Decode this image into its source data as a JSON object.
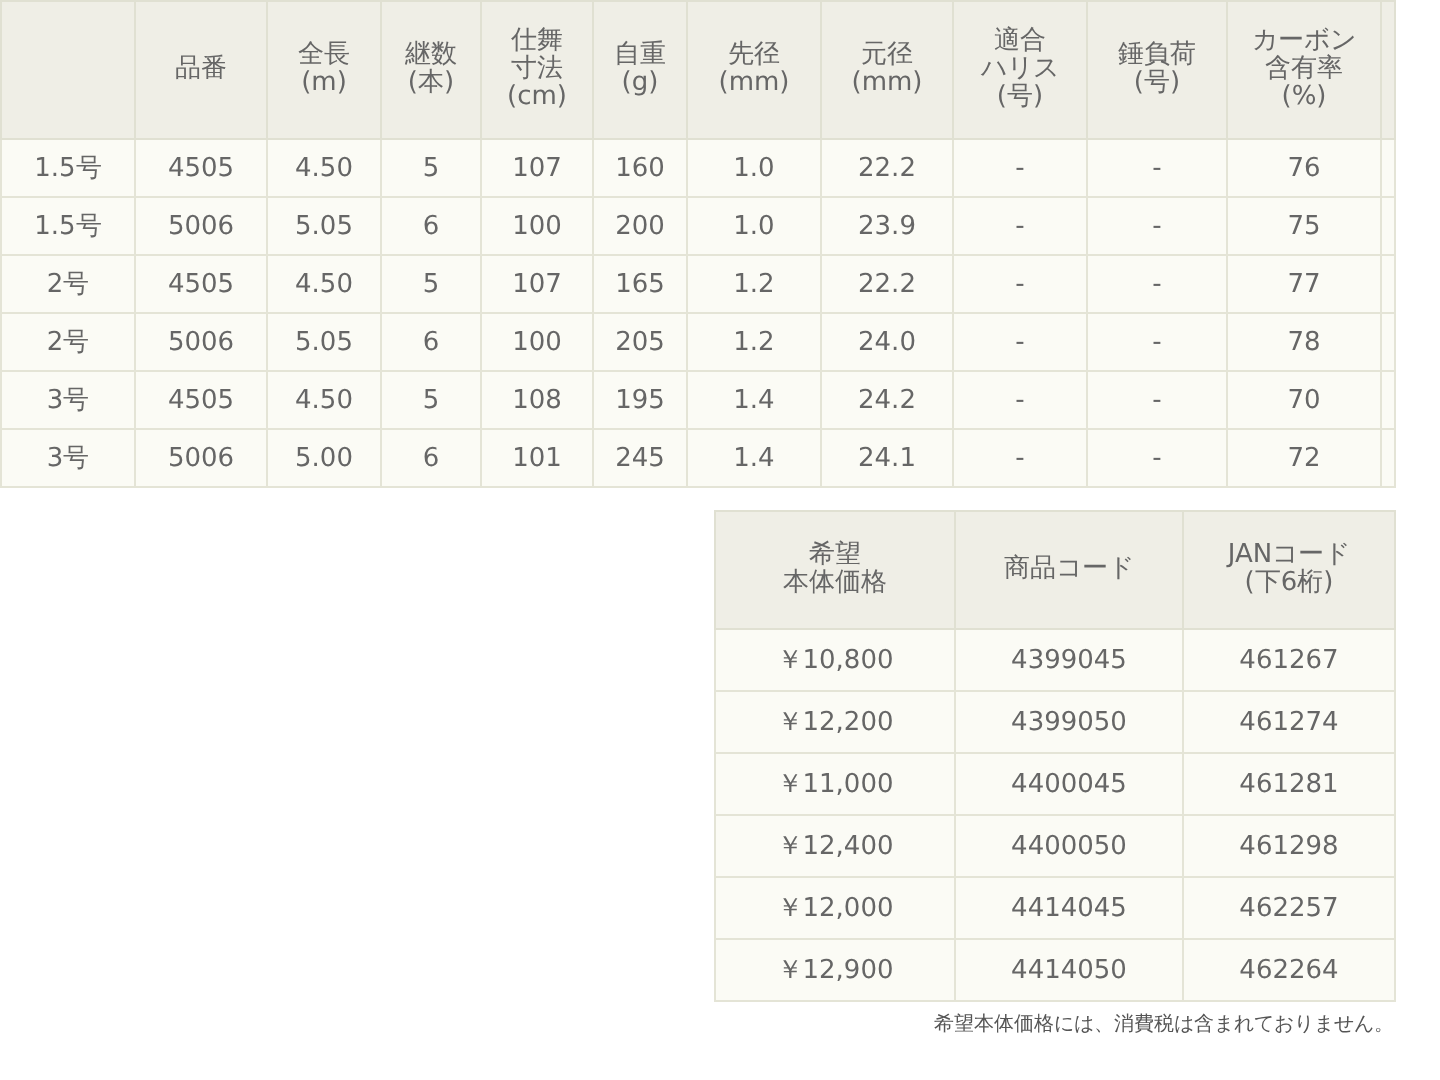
{
  "spec_table": {
    "columns": [
      {},
      {
        "lines": [
          "品番"
        ]
      },
      {
        "lines": [
          "全長",
          "(m)"
        ]
      },
      {
        "lines": [
          "継数",
          "(本)"
        ]
      },
      {
        "lines": [
          "仕舞",
          "寸法",
          "(cm)"
        ]
      },
      {
        "lines": [
          "自重",
          "(g)"
        ]
      },
      {
        "lines": [
          "先径",
          "(mm)"
        ]
      },
      {
        "lines": [
          "元径",
          "(mm)"
        ]
      },
      {
        "lines": [
          "適合",
          "ハリス",
          "(号)"
        ]
      },
      {
        "lines": [
          "錘負荷",
          "(号)"
        ]
      },
      {
        "lines": [
          "カーボン",
          "含有率",
          "(%)"
        ]
      }
    ],
    "rows": [
      [
        "1.5号",
        "4505",
        "4.50",
        "5",
        "107",
        "160",
        "1.0",
        "22.2",
        "-",
        "-",
        "76"
      ],
      [
        "1.5号",
        "5006",
        "5.05",
        "6",
        "100",
        "200",
        "1.0",
        "23.9",
        "-",
        "-",
        "75"
      ],
      [
        "2号",
        "4505",
        "4.50",
        "5",
        "107",
        "165",
        "1.2",
        "22.2",
        "-",
        "-",
        "77"
      ],
      [
        "2号",
        "5006",
        "5.05",
        "6",
        "100",
        "205",
        "1.2",
        "24.0",
        "-",
        "-",
        "78"
      ],
      [
        "3号",
        "4505",
        "4.50",
        "5",
        "108",
        "195",
        "1.4",
        "24.2",
        "-",
        "-",
        "70"
      ],
      [
        "3号",
        "5006",
        "5.00",
        "6",
        "101",
        "245",
        "1.4",
        "24.1",
        "-",
        "-",
        "72"
      ]
    ]
  },
  "price_table": {
    "columns": [
      {
        "lines": [
          "希望",
          "本体価格"
        ]
      },
      {
        "lines": [
          "商品コード"
        ]
      },
      {
        "lines": [
          "JANコード",
          "(下6桁)"
        ]
      }
    ],
    "rows": [
      [
        "￥10,800",
        "4399045",
        "461267"
      ],
      [
        "￥12,200",
        "4399050",
        "461274"
      ],
      [
        "￥11,000",
        "4400045",
        "461281"
      ],
      [
        "￥12,400",
        "4400050",
        "461298"
      ],
      [
        "￥12,000",
        "4414045",
        "462257"
      ],
      [
        "￥12,900",
        "4414050",
        "462264"
      ]
    ]
  },
  "note": "希望本体価格には、消費税は含まれておりません。"
}
